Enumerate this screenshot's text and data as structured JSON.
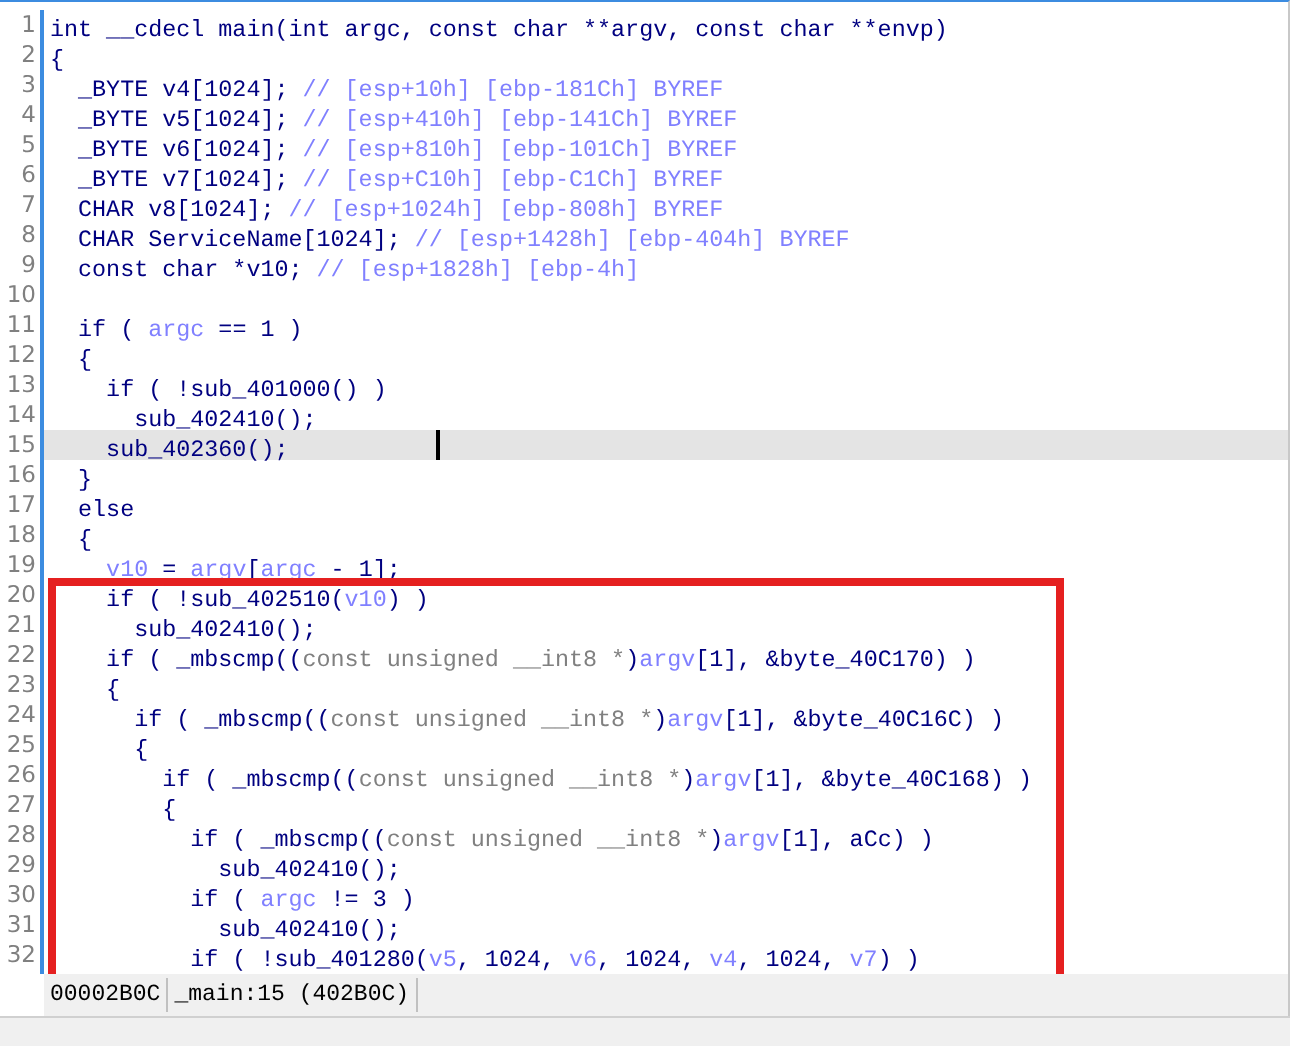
{
  "editor": {
    "lines": [
      {
        "number": "1",
        "selected": false,
        "tokens": [
          {
            "kind": "code",
            "text": "int __cdecl main(int argc, const char **argv, const char **envp)"
          }
        ]
      },
      {
        "number": "2",
        "selected": false,
        "tokens": [
          {
            "kind": "code",
            "text": "{"
          }
        ]
      },
      {
        "number": "3",
        "selected": false,
        "tokens": [
          {
            "kind": "code",
            "text": "  _BYTE v4[1024]; "
          },
          {
            "kind": "comment",
            "text": "// [esp+10h] [ebp-181Ch] BYREF"
          }
        ]
      },
      {
        "number": "4",
        "selected": false,
        "tokens": [
          {
            "kind": "code",
            "text": "  _BYTE v5[1024]; "
          },
          {
            "kind": "comment",
            "text": "// [esp+410h] [ebp-141Ch] BYREF"
          }
        ]
      },
      {
        "number": "5",
        "selected": false,
        "tokens": [
          {
            "kind": "code",
            "text": "  _BYTE v6[1024]; "
          },
          {
            "kind": "comment",
            "text": "// [esp+810h] [ebp-101Ch] BYREF"
          }
        ]
      },
      {
        "number": "6",
        "selected": false,
        "tokens": [
          {
            "kind": "code",
            "text": "  _BYTE v7[1024]; "
          },
          {
            "kind": "comment",
            "text": "// [esp+C10h] [ebp-C1Ch] BYREF"
          }
        ]
      },
      {
        "number": "7",
        "selected": false,
        "tokens": [
          {
            "kind": "code",
            "text": "  CHAR v8[1024]; "
          },
          {
            "kind": "comment",
            "text": "// [esp+1024h] [ebp-808h] BYREF"
          }
        ]
      },
      {
        "number": "8",
        "selected": false,
        "tokens": [
          {
            "kind": "code",
            "text": "  CHAR ServiceName[1024]; "
          },
          {
            "kind": "comment",
            "text": "// [esp+1428h] [ebp-404h] BYREF"
          }
        ]
      },
      {
        "number": "9",
        "selected": false,
        "tokens": [
          {
            "kind": "code",
            "text": "  const char *v10; "
          },
          {
            "kind": "comment",
            "text": "// [esp+1828h] [ebp-4h]"
          }
        ]
      },
      {
        "number": "10",
        "selected": false
      },
      {
        "number": "11",
        "selected": false,
        "tokens": [
          {
            "kind": "code",
            "text": "  if ( "
          },
          {
            "kind": "var",
            "text": "argc"
          },
          {
            "kind": "code",
            "text": " == 1 )"
          }
        ]
      },
      {
        "number": "12",
        "selected": false,
        "tokens": [
          {
            "kind": "code",
            "text": "  {"
          }
        ]
      },
      {
        "number": "13",
        "selected": false,
        "tokens": [
          {
            "kind": "code",
            "text": "    if ( !sub_401000() )"
          }
        ]
      },
      {
        "number": "14",
        "selected": false,
        "tokens": [
          {
            "kind": "code",
            "text": "      sub_402410();"
          }
        ]
      },
      {
        "number": "15",
        "selected": true,
        "tokens": [
          {
            "kind": "code",
            "text": "    sub_402360();"
          }
        ]
      },
      {
        "number": "16",
        "selected": false,
        "tokens": [
          {
            "kind": "code",
            "text": "  }"
          }
        ]
      },
      {
        "number": "17",
        "selected": false,
        "tokens": [
          {
            "kind": "code",
            "text": "  else"
          }
        ]
      },
      {
        "number": "18",
        "selected": false,
        "tokens": [
          {
            "kind": "code",
            "text": "  {"
          }
        ]
      },
      {
        "number": "19",
        "selected": false,
        "tokens": [
          {
            "kind": "var",
            "text": "    v10"
          },
          {
            "kind": "code",
            "text": " = "
          },
          {
            "kind": "var",
            "text": "argv"
          },
          {
            "kind": "code",
            "text": "["
          },
          {
            "kind": "var",
            "text": "argc"
          },
          {
            "kind": "code",
            "text": " - 1];"
          }
        ]
      },
      {
        "number": "20",
        "selected": false,
        "tokens": [
          {
            "kind": "code",
            "text": "    if ( !sub_402510("
          },
          {
            "kind": "var",
            "text": "v10"
          },
          {
            "kind": "code",
            "text": ") )"
          }
        ]
      },
      {
        "number": "21",
        "selected": false,
        "tokens": [
          {
            "kind": "code",
            "text": "      sub_402410();"
          }
        ]
      },
      {
        "number": "22",
        "selected": false,
        "tokens": [
          {
            "kind": "code",
            "text": "    if ( _mbscmp(("
          },
          {
            "kind": "cast",
            "text": "const unsigned __int8 *"
          },
          {
            "kind": "code",
            "text": ")"
          },
          {
            "kind": "var",
            "text": "argv"
          },
          {
            "kind": "code",
            "text": "[1], &byte_40C170) )"
          }
        ]
      },
      {
        "number": "23",
        "selected": false,
        "tokens": [
          {
            "kind": "code",
            "text": "    {"
          }
        ]
      },
      {
        "number": "24",
        "selected": false,
        "tokens": [
          {
            "kind": "code",
            "text": "      if ( _mbscmp(("
          },
          {
            "kind": "cast",
            "text": "const unsigned __int8 *"
          },
          {
            "kind": "code",
            "text": ")"
          },
          {
            "kind": "var",
            "text": "argv"
          },
          {
            "kind": "code",
            "text": "[1], &byte_40C16C) )"
          }
        ]
      },
      {
        "number": "25",
        "selected": false,
        "tokens": [
          {
            "kind": "code",
            "text": "      {"
          }
        ]
      },
      {
        "number": "26",
        "selected": false,
        "tokens": [
          {
            "kind": "code",
            "text": "        if ( _mbscmp(("
          },
          {
            "kind": "cast",
            "text": "const unsigned __int8 *"
          },
          {
            "kind": "code",
            "text": ")"
          },
          {
            "kind": "var",
            "text": "argv"
          },
          {
            "kind": "code",
            "text": "[1], &byte_40C168) )"
          }
        ]
      },
      {
        "number": "27",
        "selected": false,
        "tokens": [
          {
            "kind": "code",
            "text": "        {"
          }
        ]
      },
      {
        "number": "28",
        "selected": false,
        "tokens": [
          {
            "kind": "code",
            "text": "          if ( _mbscmp(("
          },
          {
            "kind": "cast",
            "text": "const unsigned __int8 *"
          },
          {
            "kind": "code",
            "text": ")"
          },
          {
            "kind": "var",
            "text": "argv"
          },
          {
            "kind": "code",
            "text": "[1], aCc) )"
          }
        ]
      },
      {
        "number": "29",
        "selected": false,
        "tokens": [
          {
            "kind": "code",
            "text": "            sub_402410();"
          }
        ]
      },
      {
        "number": "30",
        "selected": false,
        "tokens": [
          {
            "kind": "code",
            "text": "          if ( "
          },
          {
            "kind": "var",
            "text": "argc"
          },
          {
            "kind": "code",
            "text": " != 3 )"
          }
        ]
      },
      {
        "number": "31",
        "selected": false,
        "tokens": [
          {
            "kind": "code",
            "text": "            sub_402410();"
          }
        ]
      },
      {
        "number": "32",
        "selected": false,
        "tokens": [
          {
            "kind": "code",
            "text": "          if ( !sub_401280("
          },
          {
            "kind": "var",
            "text": "v5"
          },
          {
            "kind": "code",
            "text": ", 1024, "
          },
          {
            "kind": "var",
            "text": "v6"
          },
          {
            "kind": "code",
            "text": ", 1024, "
          },
          {
            "kind": "var",
            "text": "v4"
          },
          {
            "kind": "code",
            "text": ", 1024, "
          },
          {
            "kind": "var",
            "text": "v7"
          },
          {
            "kind": "code",
            "text": ") )"
          }
        ]
      }
    ]
  },
  "status_bar": {
    "address": "00002B0C",
    "location": "_main:15 (402B0C)"
  }
}
